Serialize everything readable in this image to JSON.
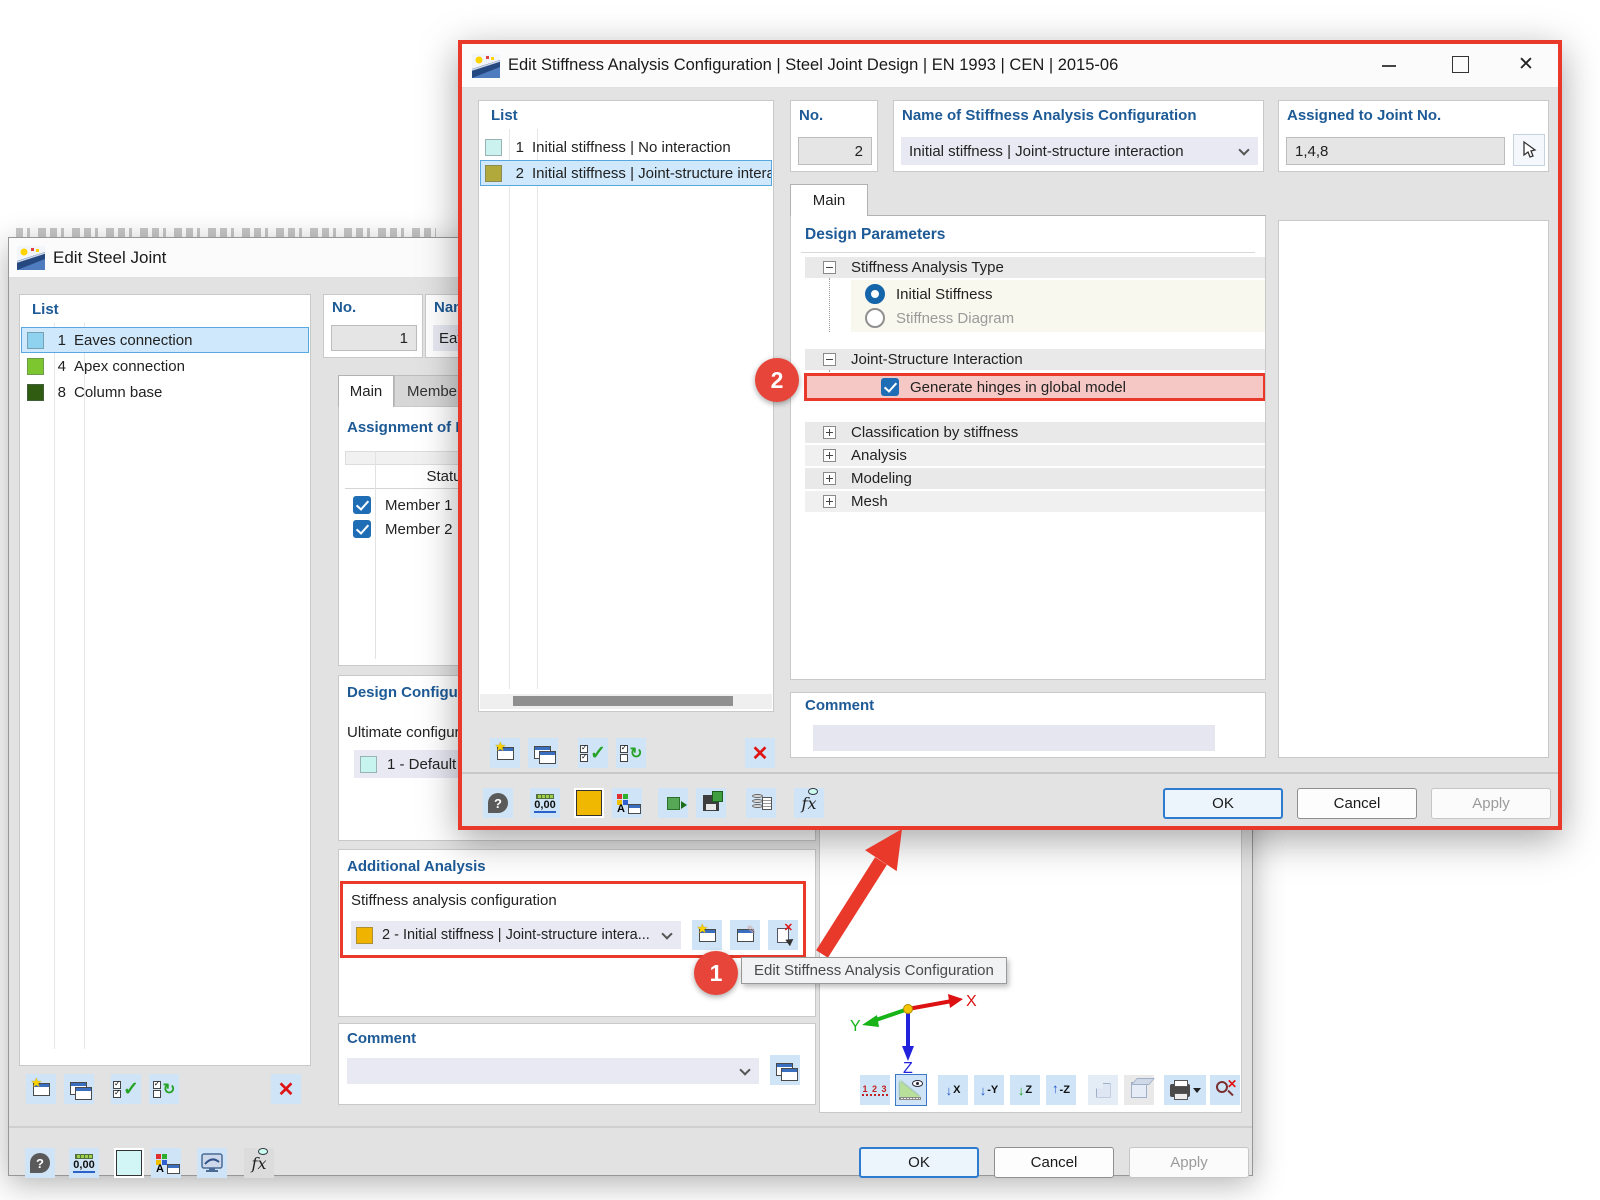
{
  "annotations": {
    "marker_1": "1",
    "marker_2": "2",
    "tooltip": "Edit Stiffness Analysis Configuration"
  },
  "icons": {
    "help": "?",
    "units": "0,00",
    "fx": "fx",
    "numbering": "1 2 3",
    "view_x": "X",
    "view_minus_y": "-Y",
    "view_z": "Z",
    "view_minus_z": "-Z",
    "letter_a": "A",
    "close": "✕",
    "minimize": "—",
    "arrow_down": "↓",
    "arrow_right": "→",
    "accent_red": "#e8392b"
  },
  "front_dialog": {
    "title": "Edit Stiffness Analysis Configuration | Steel Joint Design | EN 1993 | CEN | 2015-06",
    "list": {
      "header": "List",
      "items": [
        {
          "no": "1",
          "label": "Initial stiffness | No interaction",
          "swatch": "#ccf2ef",
          "selected": false
        },
        {
          "no": "2",
          "label": "Initial stiffness | Joint-structure interaction",
          "swatch": "#b1a93c",
          "selected": true
        }
      ]
    },
    "no_field": {
      "label": "No.",
      "value": "2"
    },
    "name_field": {
      "label": "Name of Stiffness Analysis Configuration",
      "value": "Initial stiffness | Joint-structure interaction"
    },
    "assigned_field": {
      "label": "Assigned to Joint No.",
      "value": "1,4,8"
    },
    "tab_main": "Main",
    "design": {
      "header": "Design Parameters",
      "group_stiffness_type": "Stiffness Analysis Type",
      "radio_initial": "Initial Stiffness",
      "radio_diagram": "Stiffness Diagram",
      "group_interaction": "Joint-Structure Interaction",
      "check_generate": "Generate hinges in global model",
      "group_classification": "Classification by stiffness",
      "group_analysis": "Analysis",
      "group_modeling": "Modeling",
      "group_mesh": "Mesh"
    },
    "comment_header": "Comment",
    "buttons": {
      "ok": "OK",
      "cancel": "Cancel",
      "apply": "Apply"
    }
  },
  "back_dialog": {
    "title": "Edit Steel Joint",
    "list": {
      "header": "List",
      "items": [
        {
          "no": "1",
          "label": "Eaves connection",
          "swatch": "#8ed2ef",
          "selected": true
        },
        {
          "no": "4",
          "label": "Apex connection",
          "swatch": "#7dc62f",
          "selected": false
        },
        {
          "no": "8",
          "label": "Column base",
          "swatch": "#2f5c10",
          "selected": false
        }
      ]
    },
    "no_field": {
      "label": "No.",
      "value": "1"
    },
    "name_field": {
      "label": "Name",
      "value": "Eaves connection"
    },
    "tabs": {
      "main": "Main",
      "members": "Members"
    },
    "assignment": {
      "header": "Assignment of Members",
      "status_col": "Status",
      "rows": [
        {
          "label": "Member 1",
          "checked": true
        },
        {
          "label": "Member 2",
          "checked": true
        }
      ]
    },
    "design_config": {
      "header": "Design Configurations",
      "label": "Ultimate configuration",
      "value": "1 - Default",
      "swatch": "#c8f4f0"
    },
    "additional": {
      "header": "Additional Analysis",
      "label": "Stiffness analysis configuration",
      "value": "2 - Initial stiffness | Joint-structure intera...",
      "swatch": "#f0b400"
    },
    "comment_header": "Comment",
    "buttons": {
      "ok": "OK",
      "cancel": "Cancel",
      "apply": "Apply"
    },
    "axes": {
      "x": "X",
      "y": "Y",
      "z": "Z"
    }
  }
}
